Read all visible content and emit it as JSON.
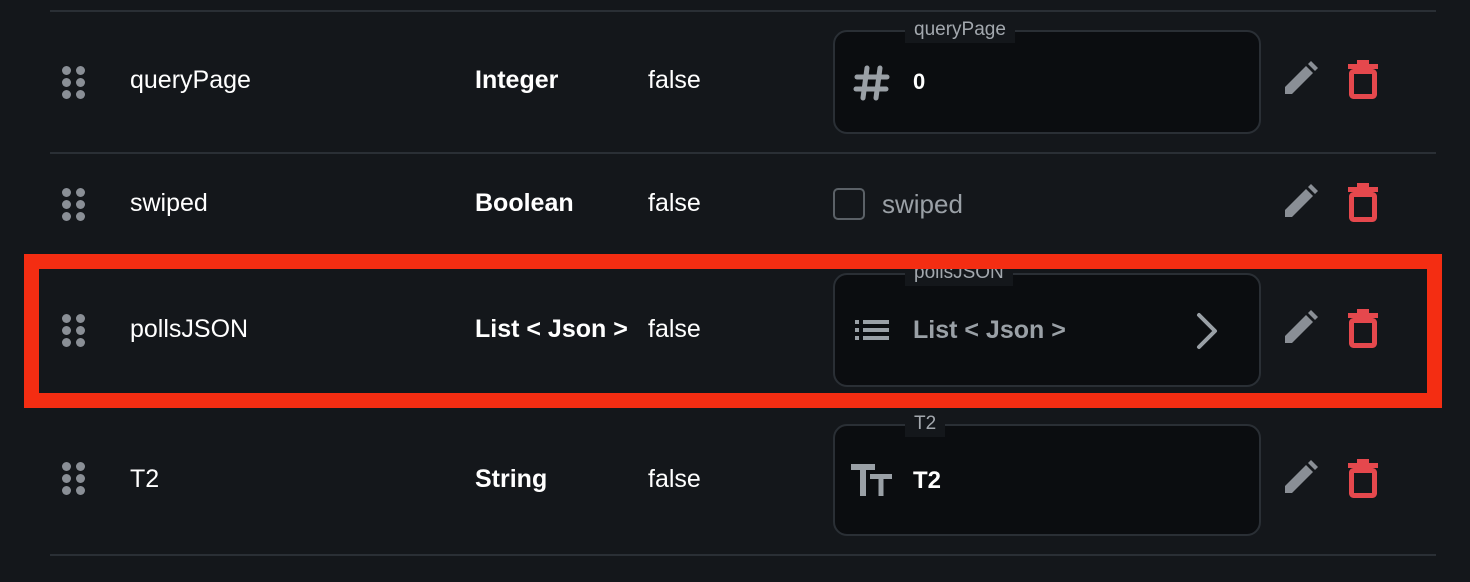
{
  "variables": [
    {
      "name": "queryPage",
      "type": "Integer",
      "nullable": "false",
      "field_kind": "number",
      "field_label": "queryPage",
      "field_value": "0",
      "icon": "hash-icon"
    },
    {
      "name": "swiped",
      "type": "Boolean",
      "nullable": "false",
      "field_kind": "checkbox",
      "field_label": "swiped",
      "checked": false,
      "icon": "checkbox-icon"
    },
    {
      "name": "pollsJSON",
      "type": "List < Json >",
      "nullable": "false",
      "field_kind": "list",
      "field_label": "pollsJSON",
      "field_value": "List < Json >",
      "icon": "list-icon",
      "highlighted": true
    },
    {
      "name": "T2",
      "type": "String",
      "nullable": "false",
      "field_kind": "text",
      "field_label": "T2",
      "field_value": "T2",
      "icon": "text-icon"
    }
  ],
  "actions": {
    "edit_icon": "pencil-icon",
    "delete_icon": "trash-icon"
  },
  "colors": {
    "background": "#14171b",
    "field_background": "#0b0d10",
    "border": "#2a2f35",
    "muted_text": "#9aa0a6",
    "delete_red": "#e5484d",
    "highlight_red": "#f42d12"
  }
}
